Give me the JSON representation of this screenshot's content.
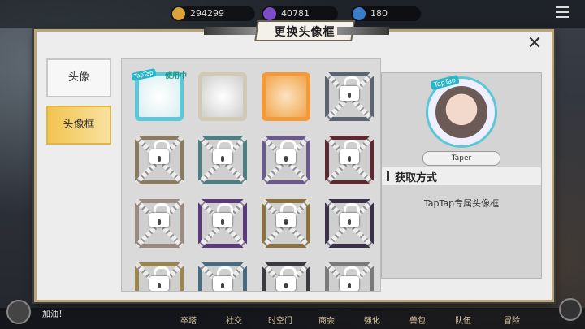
{
  "topbar": {
    "resources": [
      {
        "icon": "coin-icon",
        "value": "294299",
        "color": "#d8a43a"
      },
      {
        "icon": "gem-icon",
        "value": "40781",
        "color": "#7e4cc9"
      },
      {
        "icon": "energy-icon",
        "value": "180",
        "color": "#3b7cc9"
      }
    ]
  },
  "dialog": {
    "title": "更换头像框",
    "tabs": [
      {
        "label": "头像",
        "active": false
      },
      {
        "label": "头像框",
        "active": true
      }
    ]
  },
  "frames": [
    {
      "locked": false,
      "using": true,
      "badge": "TapTap",
      "using_label": "使用中",
      "style": "taptap",
      "color": "#5cc7d6"
    },
    {
      "locked": false,
      "using": false,
      "style": "plain",
      "color": "#cfc9b6"
    },
    {
      "locked": false,
      "using": false,
      "style": "fire",
      "color": "#f29a3a"
    },
    {
      "locked": true,
      "style": "steel",
      "color": "#5b6470"
    },
    {
      "locked": true,
      "style": "bronze",
      "color": "#8a7a60"
    },
    {
      "locked": true,
      "style": "teal",
      "color": "#4e7d82"
    },
    {
      "locked": true,
      "style": "violet",
      "color": "#6a5a8a"
    },
    {
      "locked": true,
      "style": "dark-red",
      "color": "#5a2a30"
    },
    {
      "locked": true,
      "style": "winged",
      "color": "#9a8a80"
    },
    {
      "locked": true,
      "style": "purple",
      "color": "#5b3a7a"
    },
    {
      "locked": true,
      "style": "gold",
      "color": "#8a7240"
    },
    {
      "locked": true,
      "style": "shadow",
      "color": "#3a3048"
    },
    {
      "locked": true,
      "style": "gold-partial",
      "color": "#9a8450"
    },
    {
      "locked": true,
      "style": "blue-partial",
      "color": "#4a6a80"
    },
    {
      "locked": true,
      "style": "dark-partial",
      "color": "#3a3a40"
    },
    {
      "locked": true,
      "style": "grey-partial",
      "color": "#7a7a7a"
    }
  ],
  "info": {
    "preview_badge": "TapTap",
    "name": "Taper",
    "how_header": "获取方式",
    "how_desc": "TapTap专属头像框"
  },
  "bottom": {
    "chat_text": "加油！",
    "nav": [
      "卒塔",
      "社交",
      "时空门",
      "商会",
      "强化",
      "兽包",
      "队伍",
      "冒险"
    ]
  }
}
